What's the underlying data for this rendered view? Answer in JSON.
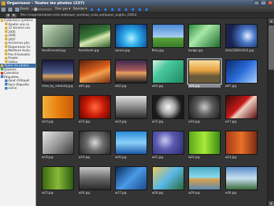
{
  "window": {
    "title": "Organiseur - Toutes les photos (237)"
  },
  "toolbar": {
    "items": [
      "Zoom",
      "Trier par",
      "Dossier"
    ]
  },
  "path": "Mes images\\windows-vista-wallpaper_windows_vista_wallpaper_anglais_22852",
  "sidebar": {
    "items": [
      {
        "label": "Collections système",
        "level": 0
      },
      {
        "label": "Ajouter une co",
        "level": 1
      },
      {
        "label": "12 derniers mo",
        "level": 1
      },
      {
        "label": "2005",
        "level": 1
      },
      {
        "label": "2006",
        "level": 1
      },
      {
        "label": "2007",
        "level": 1
      },
      {
        "label": "Anciennes pho",
        "level": 1
      },
      {
        "label": "Diaporamas Ce",
        "level": 1
      },
      {
        "label": "Meilleure évalu",
        "level": 1
      },
      {
        "label": "Pas d'évaluatio",
        "level": 1
      },
      {
        "label": "Projets",
        "level": 1
      },
      {
        "label": "Vidéos",
        "level": 1
      },
      {
        "label": "Toutes les photos",
        "level": 0,
        "selected": true
      },
      {
        "label": "Dossiers",
        "level": 0
      },
      {
        "label": "Calendrier",
        "level": 0
      },
      {
        "label": "Étiquettes",
        "level": 0
      },
      {
        "label": "Ajout d'étiquet",
        "level": 1
      },
      {
        "label": "Sans étiquette",
        "level": 1
      },
      {
        "label": "coline",
        "level": 1
      }
    ]
  },
  "photos": [
    {
      "caption": "AeroEmerald.jpg",
      "grad": "linear-gradient(135deg,#cfe0c8,#8fa88a 40%,#3d5a48)"
    },
    {
      "caption": "AeroVoods.jpg",
      "grad": "linear-gradient(160deg,#1c3a20,#3a7a3a 45%,#d8e8b0 60%,#2a5a2a)"
    },
    {
      "caption": "aurora.jpg",
      "grad": "radial-gradient(circle at 50% 60%,#b0f0ff,#2aa8e8 40%,#0a3a8a)"
    },
    {
      "caption": "Bliss.jpg",
      "grad": "linear-gradient(#4a8ad8,#a8cff0 55%,#5aa03a 60%,#3a7a2a)"
    },
    {
      "caption": "bodge.jpg",
      "grad": "linear-gradient(135deg,#2a8a3a,#a8e8a8 40%,#1a6a2a)"
    },
    {
      "caption": "Vista1280x1024.jpg",
      "grad": "radial-gradient(circle at 70% 50%,#e8f0ff,#4a78c8 30%,#1a2450 70%)"
    },
    {
      "caption": "Vista_by_relativity.jpg",
      "grad": "linear-gradient(#1a1a3a,#4a5a8a 55%,#d8a060 70%,#202030)"
    },
    {
      "caption": "w01.jpg",
      "grad": "linear-gradient(160deg,#5a2010,#d8601a 45%,#f0a050 60%,#7a2a10)"
    },
    {
      "caption": "w02.jpg",
      "grad": "linear-gradient(#3a2a50,#a85a5a 45%,#e8a060 55%,#1a1a20)"
    },
    {
      "caption": "w03.jpg",
      "grad": "linear-gradient(135deg,#d8f0e0,#4ac8a0 35%,#1a8a60)"
    },
    {
      "caption": "w04.jpg",
      "grad": "linear-gradient(#f8e0a0,#e8a040 45%,#6a5a3a 70%)",
      "selected": true
    },
    {
      "caption": "w07.jpg",
      "grad": "linear-gradient(135deg,#0a2a6a,#2a6ad8 50%,#a8d0ff)"
    },
    {
      "caption": "w10.jpg",
      "grad": "linear-gradient(90deg,#f0b040,#e88010 50%,#c85a08)"
    },
    {
      "caption": "w12.jpg",
      "grad": "radial-gradient(circle at 50% 50%,#ff6a3a,#c81a08 50%,#5a0a04)"
    },
    {
      "caption": "w14.jpg",
      "grad": "linear-gradient(#e0e0e0,#8a8a8a 50%,#2a2a2a)"
    },
    {
      "caption": "w15.jpg",
      "grad": "radial-gradient(circle at 50% 50%,#f8f8f8,#a8a8a8 35%,#1a1a1a 70%)"
    },
    {
      "caption": "w16.jpg",
      "grad": "radial-gradient(circle at 50% 50%,#c8c8c8,#5a5a5a 45%,#1a1a1a)"
    },
    {
      "caption": "w17.jpg",
      "grad": "linear-gradient(135deg,#3a0a0a,#c81a1a 45%,#f0d0c0 55%,#5a0a0a)"
    },
    {
      "caption": "w18.jpg",
      "grad": "linear-gradient(135deg,#e8e8e8,#9a9a9a 50%,#3a3a3a)"
    },
    {
      "caption": "w19.jpg",
      "grad": "radial-gradient(circle at 50% 50%,#d8d8d8,#6a6a6a 45%,#2a2a2a)"
    },
    {
      "caption": "w20.jpg",
      "grad": "linear-gradient(#2a8ad8,#8ad0f8 50%,#1a5aa8)"
    },
    {
      "caption": "w21.jpg",
      "grad": "radial-gradient(circle at 40% 40%,#c8c8f0,#5a5ab0 40%,#2a2a6a)"
    },
    {
      "caption": "w22.jpg",
      "grad": "linear-gradient(90deg,#5aa81a,#a8e83a 50%,#3a8a10)"
    },
    {
      "caption": "w23.jpg",
      "grad": "linear-gradient(90deg,#a83a1a,#e8702a 50%,#7a2a10)"
    },
    {
      "caption": "w25.jpg",
      "grad": "linear-gradient(90deg,#3a6a10,#8ab83a 50%,#2a5a10)"
    },
    {
      "caption": "w26.jpg",
      "grad": "linear-gradient(#c8c8c8,#6a6a6a 50%,#2a2a2a)"
    },
    {
      "caption": "w27.jpg",
      "grad": "linear-gradient(135deg,#0a2a5a,#4a9ae8 50%,#1a4a8a)"
    },
    {
      "caption": "w28.jpg",
      "grad": "linear-gradient(135deg,#e8c85a,#5ab8e8 50%,#2a6a3a)"
    },
    {
      "caption": "w29.jpg",
      "grad": "linear-gradient(#4aa8c8,#8ad8e8 45%,#d8a050 55%,#5a8ab0)"
    },
    {
      "caption": "w30.jpg",
      "grad": "linear-gradient(#5a8ac8,#c8e0f0 50%,#3a6a3a)"
    }
  ]
}
